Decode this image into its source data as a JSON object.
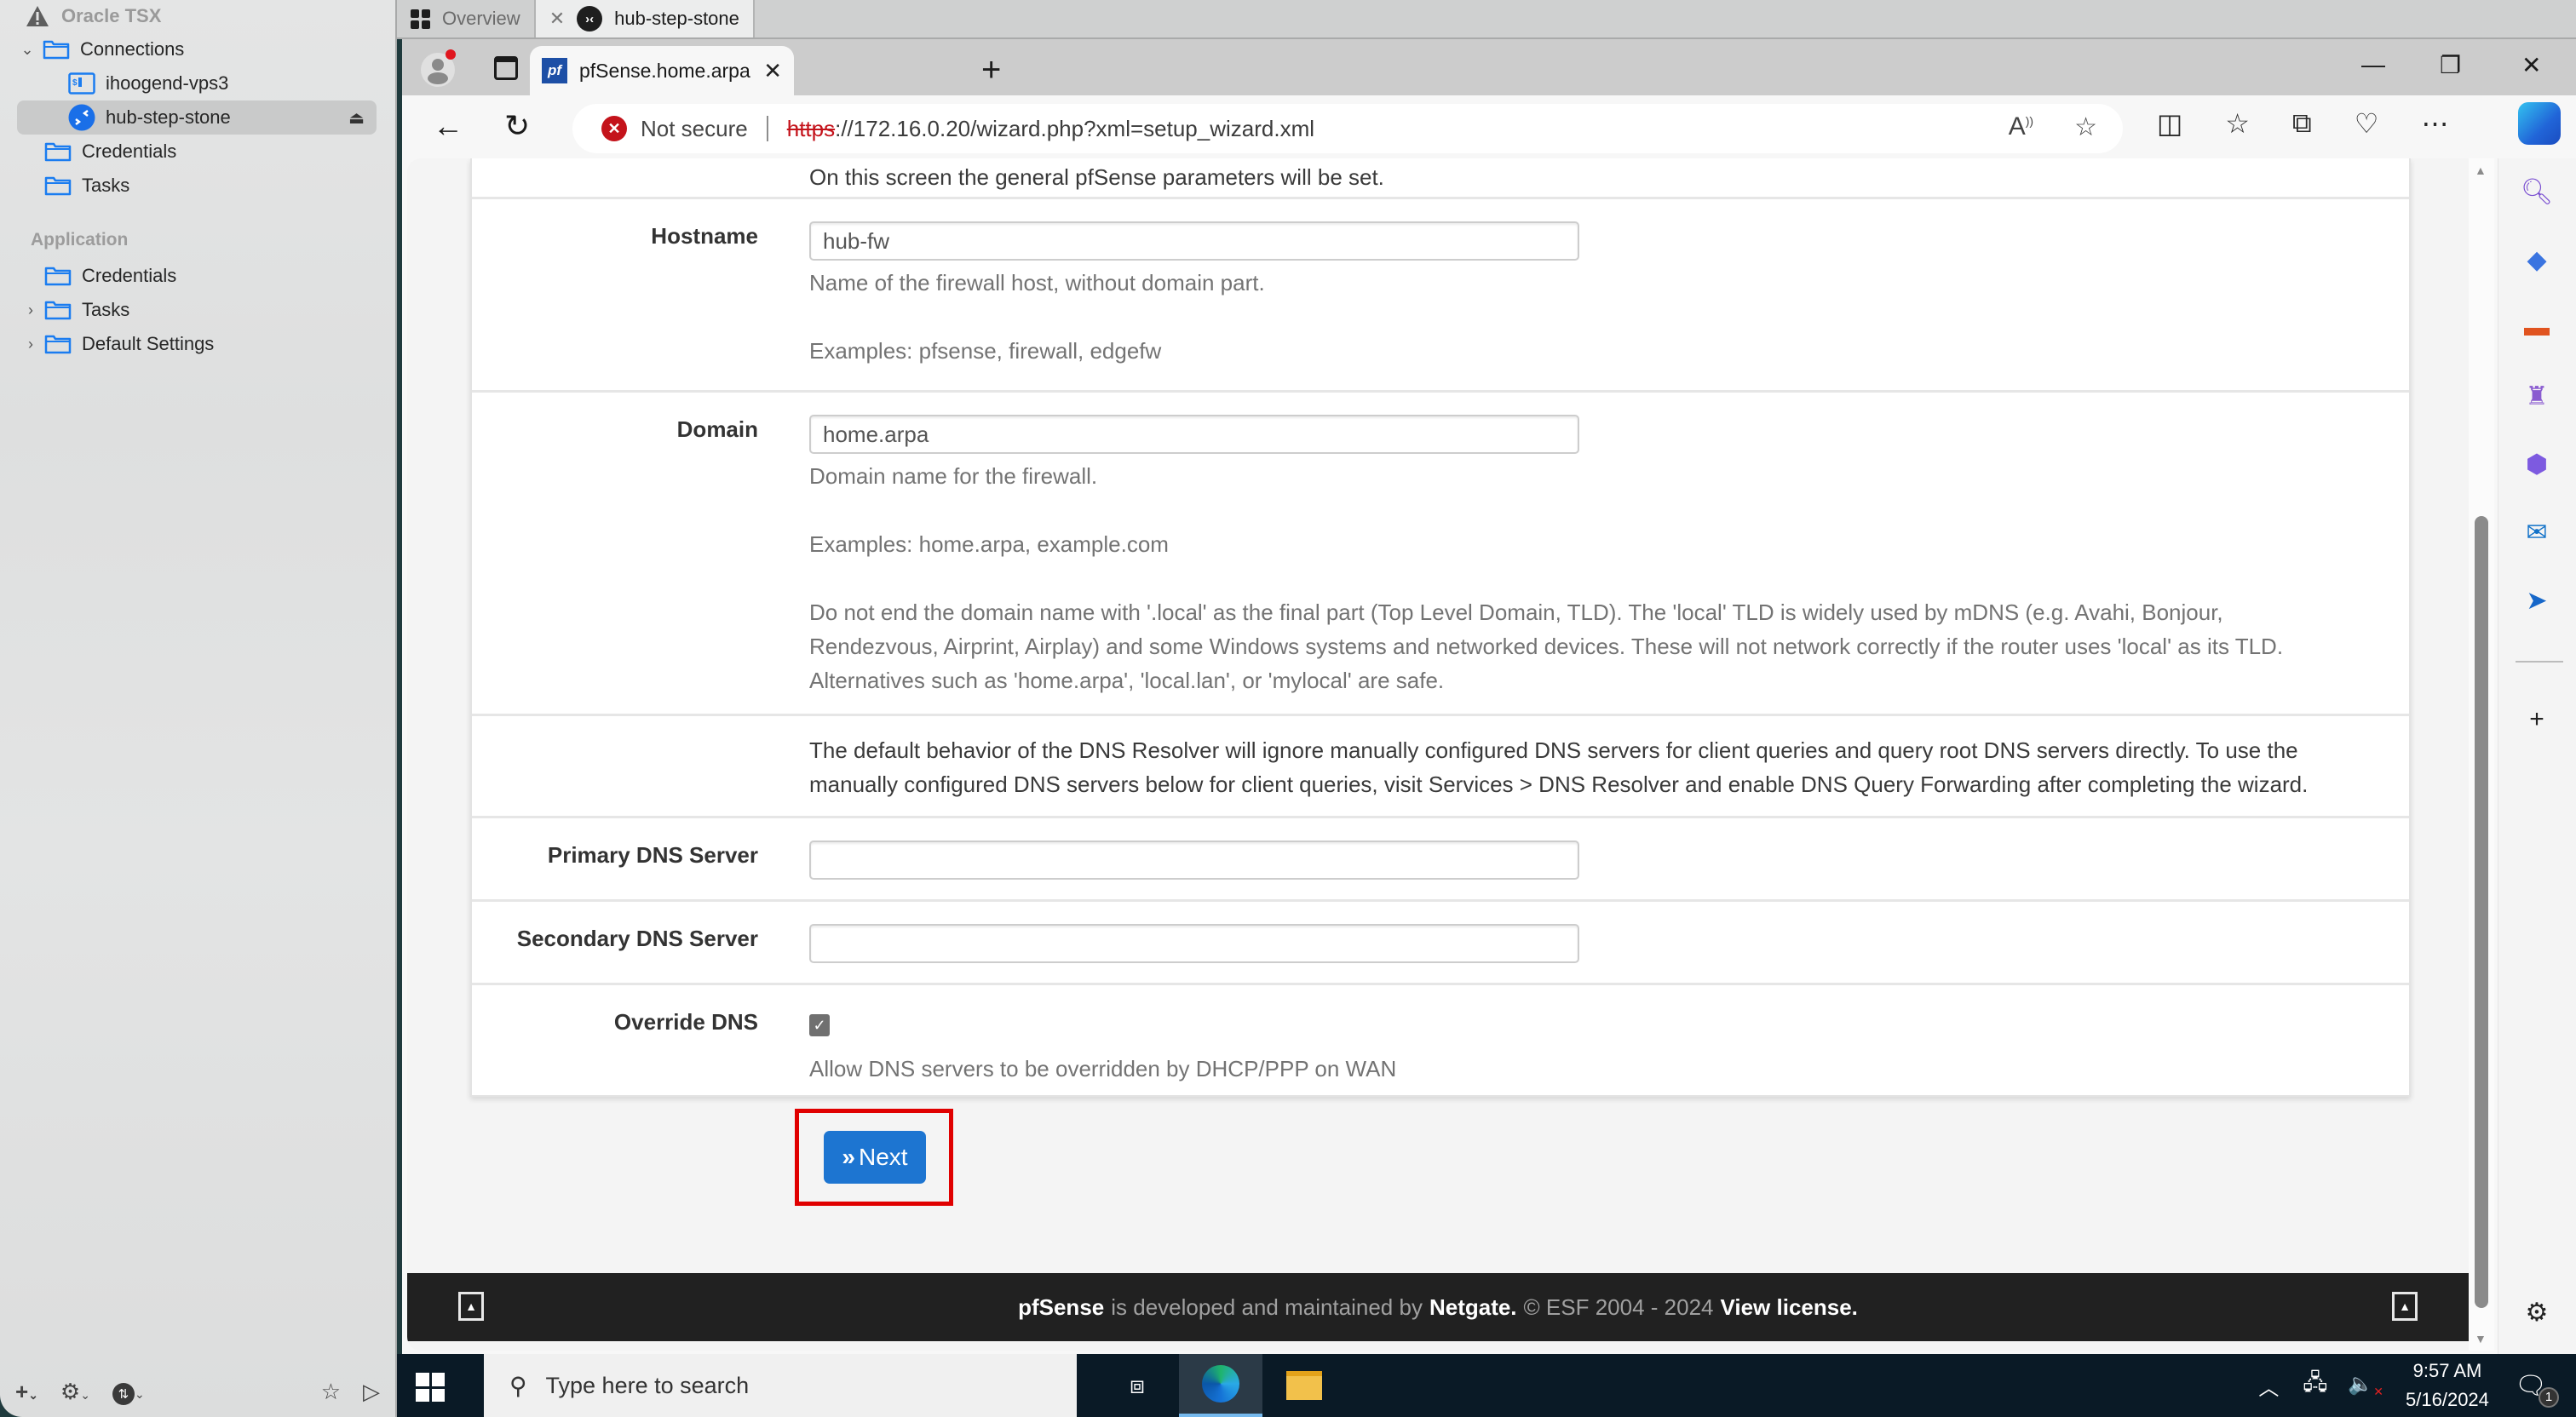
{
  "app": {
    "name": "Oracle TSX",
    "sidebar": {
      "header": "Oracle TSX",
      "connections_label": "Connections",
      "connections": [
        {
          "label": "ihoogend-vps3",
          "icon": "terminal-icon"
        },
        {
          "label": "hub-step-stone",
          "icon": "remote-desktop-icon",
          "selected": true
        }
      ],
      "items_top": [
        {
          "label": "Credentials"
        },
        {
          "label": "Tasks"
        }
      ],
      "application_section": "Application",
      "items_app": [
        {
          "label": "Credentials",
          "expandable": false
        },
        {
          "label": "Tasks",
          "expandable": true
        },
        {
          "label": "Default Settings",
          "expandable": true
        }
      ]
    },
    "tabs": [
      {
        "label": "Overview",
        "icon": "grid-icon"
      },
      {
        "label": "hub-step-stone",
        "icon": "remote-desktop-icon",
        "active": true
      }
    ]
  },
  "browser": {
    "tab_title": "pfSense.home.arpa - Wizard: pfSense Setup",
    "tab_title_visible": "pfSense.home.arpa - Wizard: pfSe",
    "security_label": "Not secure",
    "url_protocol": "https",
    "url_rest": "://172.16.0.20/wizard.php?xml=setup_wizard.xml"
  },
  "page": {
    "intro": "On this screen the general pfSense parameters will be set.",
    "hostname": {
      "label": "Hostname",
      "value": "hub-fw",
      "help1": "Name of the firewall host, without domain part.",
      "help2": "Examples: pfsense, firewall, edgefw"
    },
    "domain": {
      "label": "Domain",
      "value": "home.arpa",
      "help1": "Domain name for the firewall.",
      "help2": "Examples: home.arpa, example.com",
      "help3_line1": "Do not end the domain name with '.local' as the final part (Top Level Domain, TLD). The 'local' TLD is widely used by mDNS (e.g. Avahi, Bonjour,",
      "help3_line2": "Rendezvous, Airprint, Airplay) and some Windows systems and networked devices. These will not network correctly if the router uses 'local' as its TLD.",
      "help3_line3": "Alternatives such as 'home.arpa', 'local.lan', or 'mylocal' are safe."
    },
    "dns_note_line1": "The default behavior of the DNS Resolver will ignore manually configured DNS servers for client queries and query root DNS servers directly. To use the",
    "dns_note_line2": "manually configured DNS servers below for client queries, visit Services > DNS Resolver and enable DNS Query Forwarding after completing the wizard.",
    "primary_dns": {
      "label": "Primary DNS Server",
      "value": ""
    },
    "secondary_dns": {
      "label": "Secondary DNS Server",
      "value": ""
    },
    "override_dns": {
      "label": "Override DNS",
      "checked": true,
      "help": "Allow DNS servers to be overridden by DHCP/PPP on WAN"
    },
    "next_button": "Next",
    "footer": {
      "brand": "pfSense",
      "text1": "is developed and maintained by",
      "company": "Netgate.",
      "text2": "© ESF 2004 - 2024",
      "license": "View license."
    }
  },
  "taskbar": {
    "search_placeholder": "Type here to search",
    "time": "9:57 AM",
    "date": "5/16/2024",
    "notification_count": "1"
  },
  "colors": {
    "accent": "#1d75d1",
    "highlight": "#e00000",
    "footer_bg": "#212121",
    "not_secure": "#c4131b"
  }
}
